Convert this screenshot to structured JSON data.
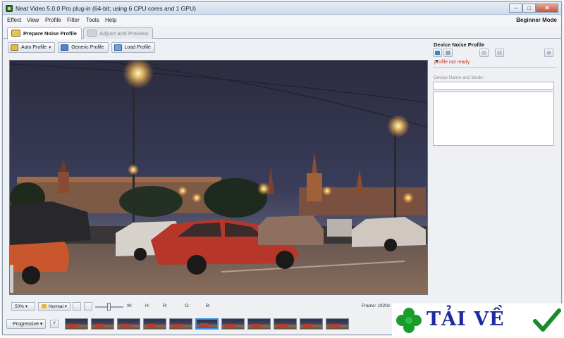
{
  "window": {
    "title": "Neat Video 5.0.0  Pro plug-in (64-bit; using 6 CPU cores and 1 GPU)",
    "controls": [
      "–",
      "□",
      "✕"
    ]
  },
  "menu": {
    "items": [
      {
        "label": "Effect",
        "underline": "E"
      },
      {
        "label": "View",
        "underline": "V"
      },
      {
        "label": "Profile",
        "underline": "P"
      },
      {
        "label": "Filter",
        "underline": "t"
      },
      {
        "label": "Tools",
        "underline": "o"
      },
      {
        "label": "Help",
        "underline": "H"
      }
    ],
    "mode": "Beginner Mode"
  },
  "tabs": [
    {
      "label": "Prepare Noise Profile",
      "active": true
    },
    {
      "label": "Adjust and Preview",
      "active": false
    }
  ],
  "toolbar": {
    "auto_profile": "Auto Profile",
    "generic_profile": "Generic Profile",
    "load_profile": "Load Profile"
  },
  "side_panel": {
    "title": "Device Noise Profile",
    "status": "profile not ready",
    "device_label": "Device Name and Mode:",
    "device_value": ""
  },
  "status_bar": {
    "zoom": "50%",
    "view_mode": "Normal",
    "w_label": "W:",
    "h_label": "H:",
    "r_label": "R:",
    "g_label": "G:",
    "b_label": "B:",
    "frame": "Frame:  1920x"
  },
  "bottom": {
    "progressive": "Progressive",
    "filter_label": "Y",
    "thumbnail_count": 11,
    "selected_thumbnail": 6
  },
  "watermark": {
    "text": "TẢI VỀ"
  },
  "colors": {
    "accent": "#3c8de0",
    "status_error": "#d42b1a",
    "watermark_text": "#1f2a9e",
    "clover": "#1a9b2e",
    "check": "#1a8a2a"
  }
}
